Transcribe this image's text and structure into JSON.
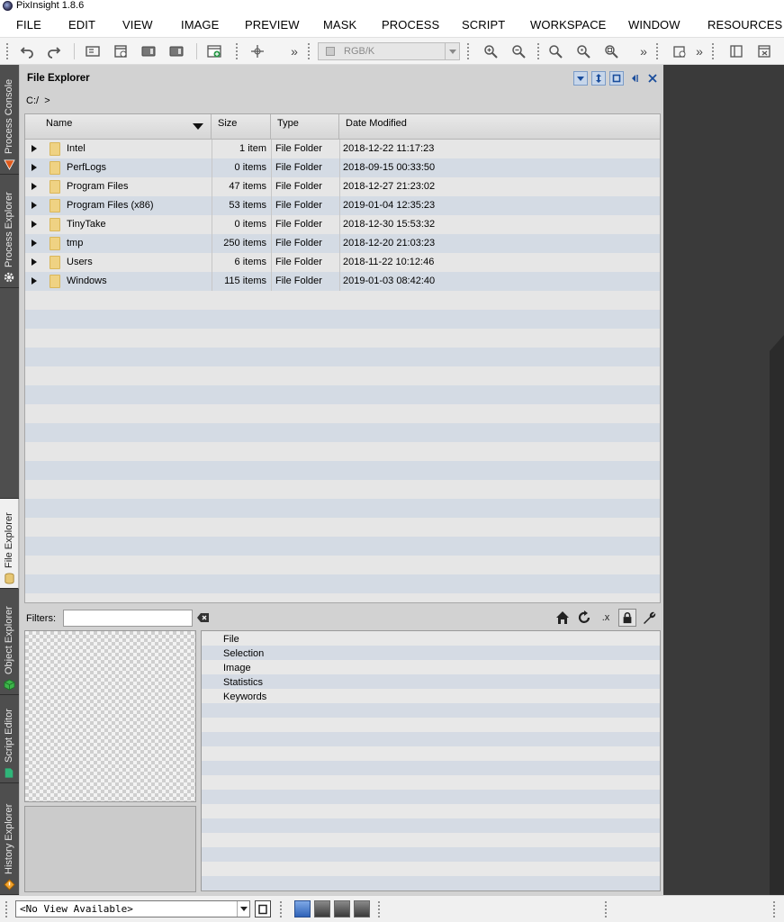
{
  "window": {
    "title": "PixInsight 1.8.6"
  },
  "menu": [
    "FILE",
    "EDIT",
    "VIEW",
    "IMAGE",
    "PREVIEW",
    "MASK",
    "PROCESS",
    "SCRIPT",
    "WORKSPACE",
    "WINDOW",
    "RESOURCES"
  ],
  "toolbar": {
    "color_mode": "RGB/K",
    "overflow_1": "»",
    "overflow_2": "»",
    "overflow_3": "»"
  },
  "sidebar_tabs": [
    "Process Console",
    "Process Explorer",
    "File Explorer",
    "Object Explorer",
    "Script Editor",
    "History Explorer"
  ],
  "panel": {
    "title": "File Explorer",
    "path": "C:/",
    "path_sep": ">",
    "columns": [
      "Name",
      "Size",
      "Type",
      "Date Modified"
    ],
    "rows": [
      {
        "name": "Intel",
        "size": "1 item",
        "type": "File Folder",
        "date": "2018-12-22 11:17:23"
      },
      {
        "name": "PerfLogs",
        "size": "0 items",
        "type": "File Folder",
        "date": "2018-09-15 00:33:50"
      },
      {
        "name": "Program Files",
        "size": "47 items",
        "type": "File Folder",
        "date": "2018-12-27 21:23:02"
      },
      {
        "name": "Program Files (x86)",
        "size": "53 items",
        "type": "File Folder",
        "date": "2019-01-04 12:35:23"
      },
      {
        "name": "TinyTake",
        "size": "0 items",
        "type": "File Folder",
        "date": "2018-12-30 15:53:32"
      },
      {
        "name": "tmp",
        "size": "250 items",
        "type": "File Folder",
        "date": "2018-12-20 21:03:23"
      },
      {
        "name": "Users",
        "size": "6 items",
        "type": "File Folder",
        "date": "2018-11-22 10:12:46"
      },
      {
        "name": "Windows",
        "size": "115 items",
        "type": "File Folder",
        "date": "2019-01-03 08:42:40"
      }
    ],
    "filters_label": "Filters:",
    "filters_value": "",
    "ext_label": ".x",
    "properties": [
      "File",
      "Selection",
      "Image",
      "Statistics",
      "Keywords"
    ]
  },
  "status": {
    "view_selector": "<No View Available>"
  }
}
